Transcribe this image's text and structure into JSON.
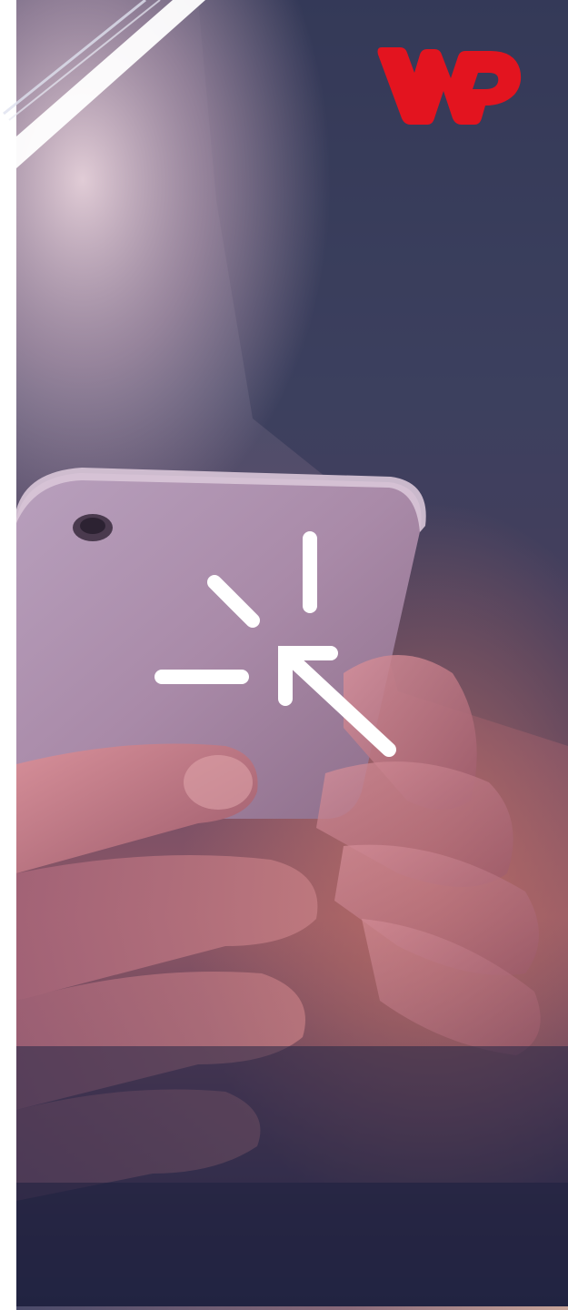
{
  "ad": {
    "brand": "WP",
    "logo_color": "#e3141f",
    "background_gradient": [
      "#3c3e5c",
      "#6d4a66",
      "#a85a6a",
      "#262845"
    ],
    "icon": "click-cursor-icon",
    "icon_color": "#ffffff"
  }
}
